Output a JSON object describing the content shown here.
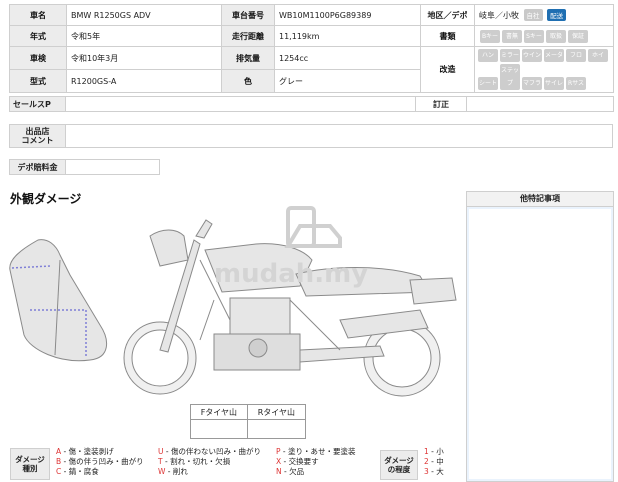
{
  "info": {
    "rows": [
      [
        {
          "label": "車名",
          "value": "BMW R1250GS ADV"
        },
        {
          "label": "車台番号",
          "value": "WB10M1100P6G89389"
        }
      ],
      [
        {
          "label": "年式",
          "value": "令和5年"
        },
        {
          "label": "走行距離",
          "value": "11,119km"
        }
      ],
      [
        {
          "label": "車検",
          "value": "令和10年3月"
        },
        {
          "label": "排気量",
          "value": "1254cc"
        }
      ],
      [
        {
          "label": "型式",
          "value": "R1200GS-A"
        },
        {
          "label": "色",
          "value": "グレー"
        }
      ]
    ],
    "region_label": "地区／デポ",
    "region_value": "岐阜／小牧",
    "region_tags": [
      "自社",
      "配送"
    ],
    "docs_label": "書類",
    "docs_chips": [
      "Bキー",
      "書無",
      "Sキー",
      "取扱",
      "保証"
    ],
    "mod_label": "改造",
    "mod_chips": [
      "ハン",
      "ミラー",
      "ウイン",
      "メータ",
      "フロ",
      "ホイ",
      "シート",
      "ステップ",
      "マフラ",
      "サイレ",
      "Rサス"
    ]
  },
  "sales_point_label": "セールスP",
  "reason_label": "訂正",
  "exhibitor_label": "出品店\nコメント",
  "depot_fee_label": "デポ賠料金",
  "damage_title": "外観ダメージ",
  "notes_title": "他特記事項",
  "watermark": "mudah.my",
  "tyre": {
    "front": "Fタイヤ山",
    "rear": "Rタイヤ山"
  },
  "legend": {
    "type_label": "ダメージ\n種別",
    "col1": [
      "A - 傷・塗装剥げ",
      "B - 傷の伴う凹み・曲がり",
      "C - 錆・腐食"
    ],
    "col2": [
      "U - 傷の伴わない凹み・曲がり",
      "T - 割れ・切れ・欠損",
      "W - 削れ"
    ],
    "col3": [
      "P - 塗り・あせ・要塗装",
      "X - 交換要す",
      "N - 欠品"
    ],
    "level_label": "ダメージ\nの程度",
    "levels": [
      "1 - 小",
      "2 - 中",
      "3 - 大"
    ]
  }
}
